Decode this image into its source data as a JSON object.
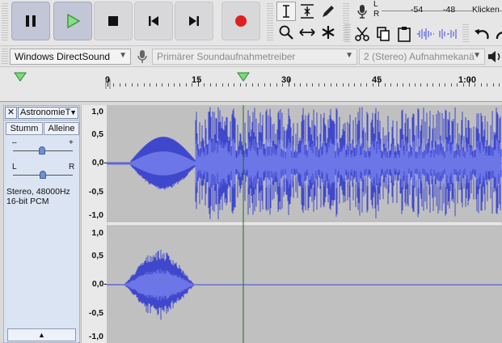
{
  "transport": {
    "pause_icon": "pause-icon",
    "play_icon": "play-icon",
    "stop_icon": "stop-icon",
    "skip_start_icon": "skip-to-start-icon",
    "skip_end_icon": "skip-to-end-icon",
    "record_icon": "record-icon",
    "record_color": "#e02020",
    "play_color": "#2fa32f"
  },
  "meter": {
    "left_label": "L",
    "right_label": "R",
    "scale": [
      "-54",
      "-48"
    ],
    "click_hint": "Klicken"
  },
  "devices": {
    "host": "Windows DirectSound",
    "input_device": "Primärer Soundaufnahmetreiber",
    "channels": "2 (Stereo) Aufnahmekanä"
  },
  "ruler": {
    "labels": [
      "0",
      "15",
      "30",
      "45",
      "1:00"
    ]
  },
  "track": {
    "close": "✕",
    "name": "AstronomieT",
    "mute": "Stumm",
    "solo": "Alleine",
    "gain_minus": "–",
    "gain_plus": "+",
    "pan_left": "L",
    "pan_right": "R",
    "format_line1": "Stereo, 48000Hz",
    "format_line2": "16-bit PCM",
    "collapse": "▲"
  },
  "vscale": {
    "labels": [
      "1,0",
      "0,5",
      "0,0-",
      "-0,5",
      "-1,0"
    ]
  },
  "colors": {
    "waveform": "#3f48cc",
    "waveform_rms": "#6c76e6",
    "background": "#c0c0c0",
    "playhead": "#1e6b2a"
  }
}
